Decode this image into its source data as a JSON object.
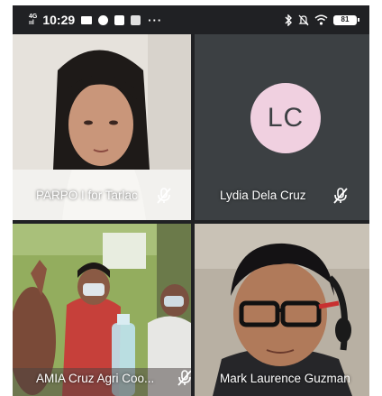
{
  "status_bar": {
    "network_top": "4G",
    "network_bottom": "ııl",
    "time": "10:29",
    "more": "···",
    "battery": "81"
  },
  "participants": [
    {
      "name": "PARPO I for Tarlac",
      "muted": true,
      "video": true
    },
    {
      "name": "Lydia Dela Cruz",
      "initials": "LC",
      "muted": true,
      "video": false,
      "avatar_color": "#f0d0e0"
    },
    {
      "name": "AMIA Cruz Agri Coo...",
      "muted": true,
      "video": true
    },
    {
      "name": "Mark Laurence Guzman",
      "muted": false,
      "video": true
    }
  ],
  "icons": {
    "mute": "mic-off-icon",
    "signal": "signal-icon",
    "wifi": "wifi-icon",
    "bluetooth": "bluetooth-icon",
    "dnd": "bell-off-icon"
  },
  "colors": {
    "background": "#202124",
    "tile_empty": "#3c4043",
    "avatar": "#f0d0e0"
  }
}
